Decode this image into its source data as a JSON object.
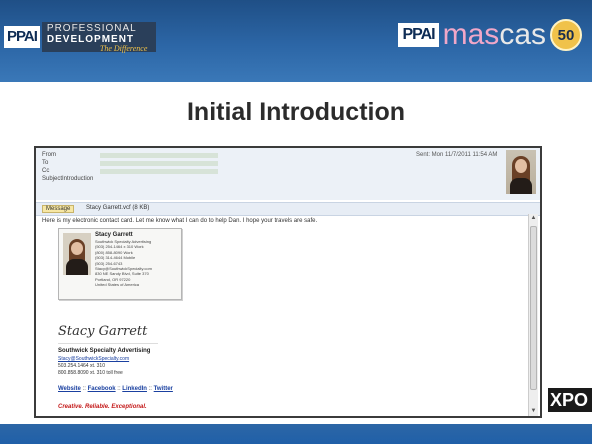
{
  "header": {
    "left_logo": {
      "ppai": "PPAI",
      "line1": "PROFESSIONAL",
      "line2": "DEVELOPMENT",
      "tagline": "The Difference"
    },
    "right_logo": {
      "ppai": "PPAI",
      "mas": "mas",
      "cas": "cas",
      "badge": "50"
    }
  },
  "slide": {
    "title": "Initial Introduction"
  },
  "email": {
    "labels": {
      "from": "From",
      "to": "To",
      "cc": "Cc",
      "subject": "Subject"
    },
    "subject": "Introduction",
    "sent": "Sent:  Mon 11/7/2011 11:54 AM",
    "tabs": [
      "Message",
      "Stacy Garrett.vcf (8 KB)"
    ],
    "body_line": "Here is my electronic contact card.  Let me know what I can do to help Dan.  I hope your travels are safe.",
    "card": {
      "name": "Stacy Garrett",
      "lines": [
        "Southwick Specialty Advertising",
        "(503) 254-1464 x 310 Work",
        "(800) 858-8090 Work",
        "(503) 314-4644 Mobile",
        "(503) 254-6743",
        "Stacy@SouthwickSpecialty.com",
        "830 NE Sandy Blvd, Suite 370",
        "Portland, OR  97220",
        "United States of America"
      ]
    },
    "signature": "Stacy Garrett",
    "company": "Southwick Specialty Advertising",
    "contact": [
      "Stacy@SouthwickSpecialty.com",
      "503.254.1464 xt. 310",
      "800.858.8090 xt. 310 toll free"
    ],
    "links": [
      "Website",
      "Facebook",
      "LinkedIn",
      "Twitter"
    ],
    "link_sep": "::",
    "tagline": "Creative. Reliable. Exceptional."
  },
  "corner": {
    "expo": "XPO"
  },
  "colors": {
    "header": "#2c66a6",
    "mascas_pink": "#f0a7c8",
    "badge_gold": "#f0c24a",
    "tagline_red": "#c41a1a"
  }
}
